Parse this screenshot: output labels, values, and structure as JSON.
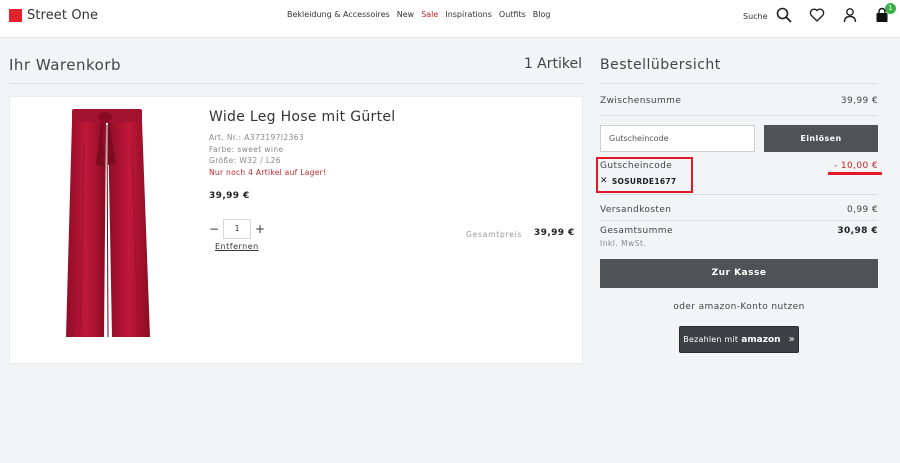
{
  "header": {
    "logo_text": "Street One",
    "nav": [
      "Bekleidung & Accessoires",
      "New",
      "Sale",
      "Inspirations",
      "Outfits",
      "Blog"
    ],
    "search_label": "Suche",
    "cart_badge": "1"
  },
  "cart": {
    "title": "Ihr Warenkorb",
    "count": "1 Artikel",
    "item": {
      "name": "Wide Leg Hose mit Gürtel",
      "article_no": "Art. Nr.: A373197I2363",
      "color": "Farbe: sweet wine",
      "size": "Größe: W32 / L26",
      "stock": "Nur noch 4 Artikel auf Lager!",
      "price": "39,99 €",
      "quantity": "1",
      "remove_label": "Entfernen",
      "total_label": "Gesamtpreis",
      "total_value": "39,99 €"
    }
  },
  "summary": {
    "title": "Bestellübersicht",
    "subtotal_label": "Zwischensumme",
    "subtotal_value": "39,99 €",
    "coupon_placeholder": "Gutscheincode",
    "redeem_label": "Einlösen",
    "coupon_label": "Gutscheincode",
    "coupon_code": "SOSURDE1677",
    "discount_value": "- 10,00 €",
    "shipping_label": "Versandkosten",
    "shipping_value": "0,99 €",
    "total_label": "Gesamtsumme",
    "total_value": "30,98 €",
    "vat_note": "Inkl. MwSt.",
    "checkout_label": "Zur Kasse",
    "amazon_hint": "oder amazon-Konto nutzen",
    "amazon_button_text": "Bezahlen mit",
    "amazon_brand": "amazon"
  },
  "colors": {
    "brand_red": "#e4222d",
    "button_dark": "#4f5356",
    "sale_red": "#c1272d",
    "highlight_red": "#e0182a",
    "badge_green": "#3cb24a"
  },
  "icons": [
    "search-icon",
    "heart-icon",
    "user-icon",
    "bag-icon",
    "close-icon",
    "chevrons-right-icon"
  ]
}
